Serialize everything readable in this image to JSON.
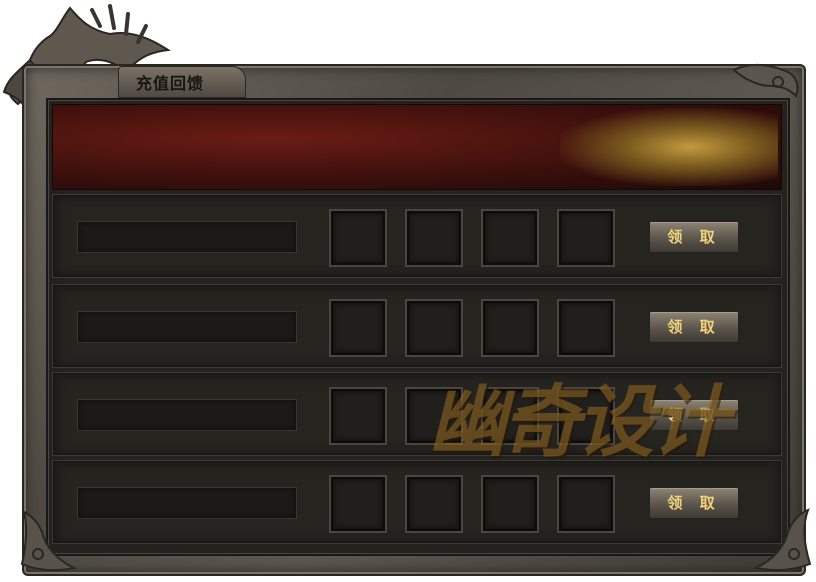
{
  "window": {
    "title": "充值回馈"
  },
  "rows": [
    {
      "button_label": "领 取"
    },
    {
      "button_label": "领 取"
    },
    {
      "button_label": "领 取"
    },
    {
      "button_label": "领 取"
    }
  ],
  "watermark": "幽奇设计",
  "colors": {
    "button_text": "#f0d27a",
    "banner_red": "#6a1c14",
    "panel_dark": "#24221f"
  },
  "icons": [
    "dragon-head-ornament",
    "corner-ornament"
  ]
}
